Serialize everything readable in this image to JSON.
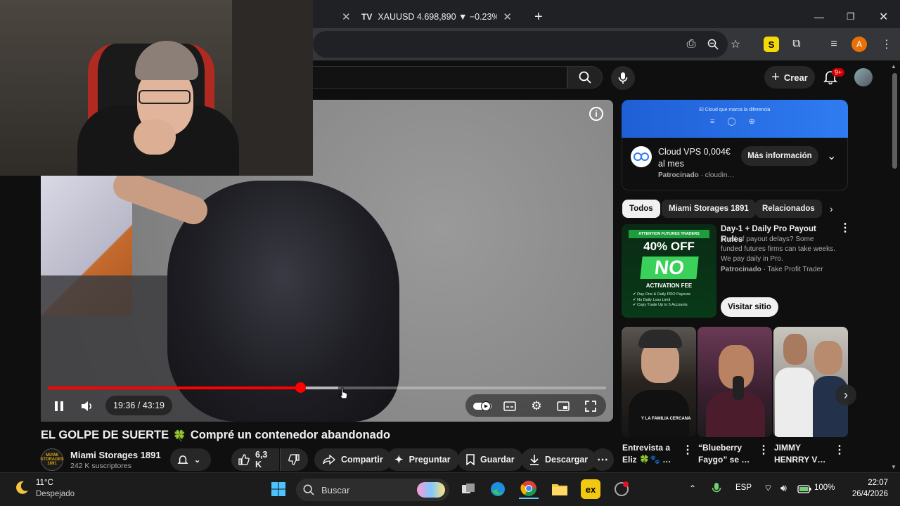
{
  "browser": {
    "tabs": [
      {
        "title": "",
        "active": false
      },
      {
        "title": "XAUUSD 4.698,890 ▼ −0.23% S",
        "active": false
      }
    ],
    "profile_initial": "A",
    "extension_badge": "S"
  },
  "youtube": {
    "header": {
      "create_label": "Crear",
      "notifications_badge": "9+"
    },
    "player": {
      "current_time": "19:36",
      "duration": "43:19",
      "time_display": "19:36 / 43:19",
      "progress_fraction": 0.452,
      "buffered_fraction": 0.52
    },
    "video": {
      "title_left": "EL GOLPE DE SUERTE",
      "title_emoji": "🍀",
      "title_right": "Compré un contenedor abandonado",
      "channel_name": "Miami Storages 1891",
      "channel_subs": "242 K suscriptores",
      "channel_avatar_text": "MIAMI STORAGES 1891",
      "likes": "6,3 K",
      "share_label": "Compartir",
      "ask_label": "Preguntar",
      "save_label": "Guardar",
      "download_label": "Descargar"
    },
    "ad": {
      "banner_text": "El Cloud que marca la diferencia",
      "title": "Cloud VPS 0,004€ al mes",
      "sponsor_label": "Patrocinado",
      "sponsor_name": "cloudin…",
      "more_label": "Más información",
      "logo_text": "cloudingio"
    },
    "chips": [
      "Todos",
      "Miami Storages 1891",
      "Relacionados"
    ],
    "promo": {
      "banner": "ATTENTION FUTURES TRADERS",
      "big_offer": "40% OFF",
      "no_text": "NO",
      "fee_text": "ACTIVATION FEE",
      "bullets": [
        "Day-One & Daily PRO Payouts",
        "No Daily Loss Limit",
        "Copy Trade Up to 5 Accounts"
      ],
      "title": "Day-1 + Daily Pro Payout Rules",
      "description": "Tired of payout delays? Some funded futures firms can take weeks. We pay daily in Pro.",
      "sponsor_label": "Patrocinado",
      "sponsor_name": "Take Profit Trader",
      "visit_label": "Visitar sitio"
    },
    "shorts": [
      {
        "title": "Entrevista a Eliz 🍀🐾 …",
        "overlay": "Y LA FAMILIA CERCANA"
      },
      {
        "title": "“Blueberry Faygo” se …",
        "overlay": ""
      },
      {
        "title": "JIMMY HENRRY V…",
        "overlay": ""
      }
    ]
  },
  "taskbar": {
    "weather_temp": "11°C",
    "weather_desc": "Despejado",
    "search_placeholder": "Buscar",
    "language": "ESP",
    "battery": "100%",
    "time": "22:07",
    "date": "26/4/2026"
  },
  "colors": {
    "yt_bg": "#0f0f0f",
    "progress": "#ff0000",
    "chip_active": "#f1f1f1",
    "ad_blue": "#2f7cf0",
    "promo_green": "#3ad15a"
  }
}
